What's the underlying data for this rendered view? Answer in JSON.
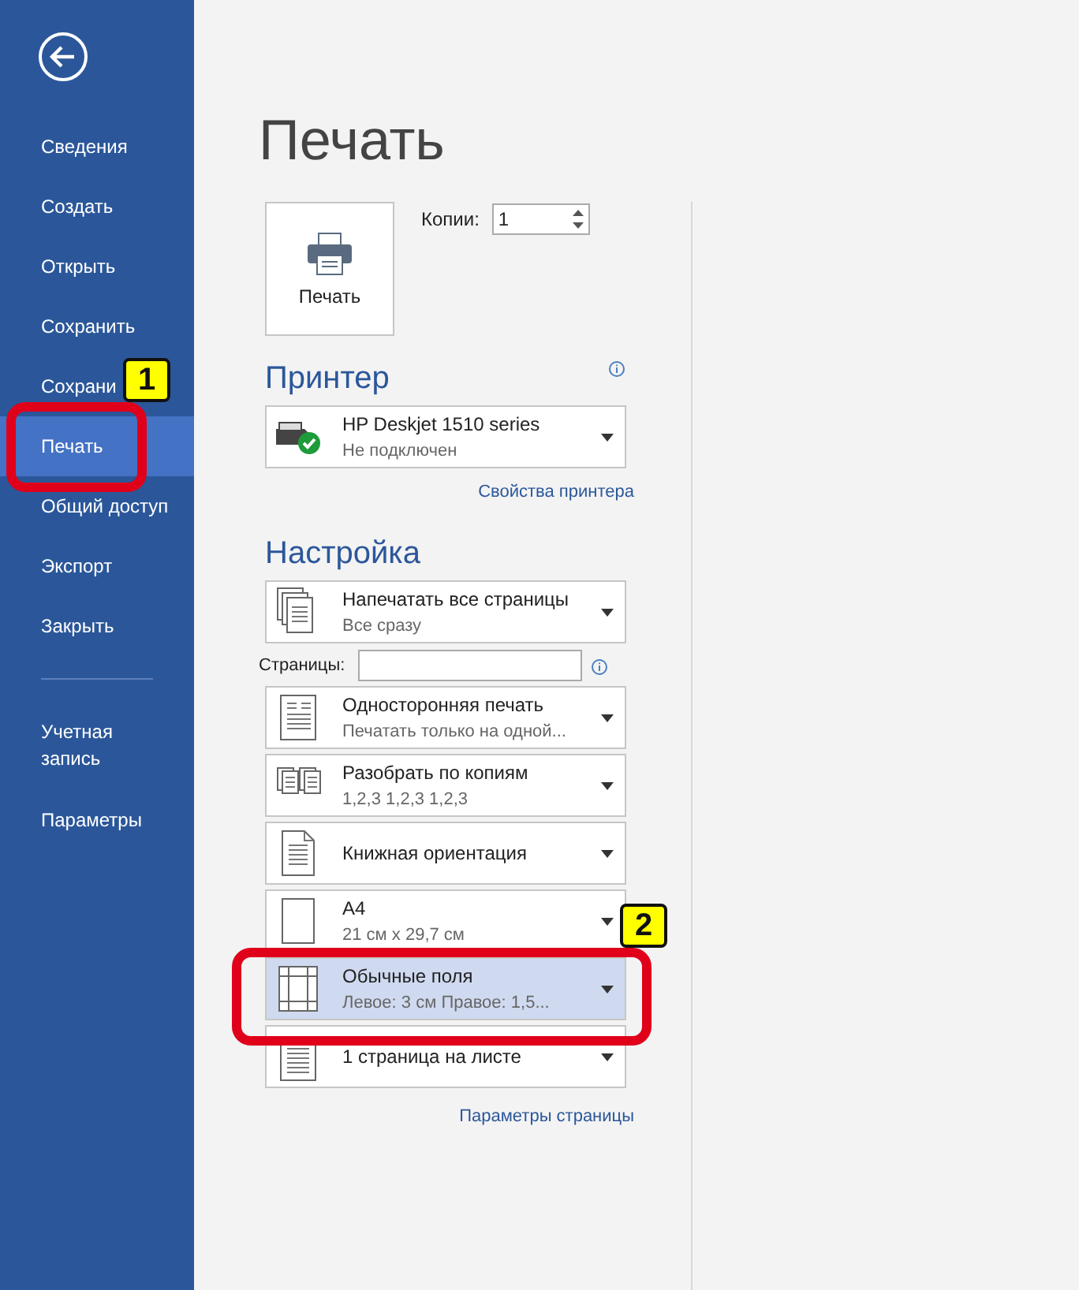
{
  "sidebar": {
    "items": [
      {
        "label": "Сведения",
        "selected": false
      },
      {
        "label": "Создать",
        "selected": false
      },
      {
        "label": "Открыть",
        "selected": false
      },
      {
        "label": "Сохранить",
        "selected": false
      },
      {
        "label": "Сохрани",
        "selected": false
      },
      {
        "label": "Печать",
        "selected": true
      },
      {
        "label": "Общий доступ",
        "selected": false
      },
      {
        "label": "Экспорт",
        "selected": false
      },
      {
        "label": "Закрыть",
        "selected": false
      }
    ],
    "bottom_items": [
      {
        "label": "Учетная запись",
        "selected": false
      },
      {
        "label": "Параметры",
        "selected": false
      }
    ]
  },
  "page_title": "Печать",
  "print_button": {
    "label": "Печать"
  },
  "copies": {
    "label": "Копии:",
    "value": "1"
  },
  "printer": {
    "heading": "Принтер",
    "name": "HP Deskjet 1510 series",
    "status": "Не подключен",
    "link": "Свойства принтера"
  },
  "settings": {
    "heading": "Настройка",
    "items": [
      {
        "kind": "all-pages",
        "title": "Напечатать все страницы",
        "subtitle": "Все сразу",
        "selected": false
      },
      {
        "kind": "pages-field",
        "label": "Страницы:"
      },
      {
        "kind": "one-sided",
        "title": "Односторонняя печать",
        "subtitle": "Печатать только на одной...",
        "selected": false
      },
      {
        "kind": "collate",
        "title": "Разобрать по копиям",
        "subtitle": "1,2,3    1,2,3    1,2,3",
        "selected": false
      },
      {
        "kind": "portrait",
        "title": "Книжная ориентация",
        "selected": false
      },
      {
        "kind": "paper",
        "title": "A4",
        "subtitle": "21 см x 29,7 см",
        "selected": false
      },
      {
        "kind": "margins",
        "title": "Обычные поля",
        "subtitle": "Левое:  3 см    Правое:  1,5...",
        "selected": true
      },
      {
        "kind": "pages-per-sheet",
        "title": "1 страница на листе",
        "selected": false
      }
    ],
    "link": "Параметры страницы"
  },
  "annotations": [
    {
      "label": "1",
      "kind": "sidebar"
    },
    {
      "label": "2",
      "kind": "setting"
    }
  ]
}
